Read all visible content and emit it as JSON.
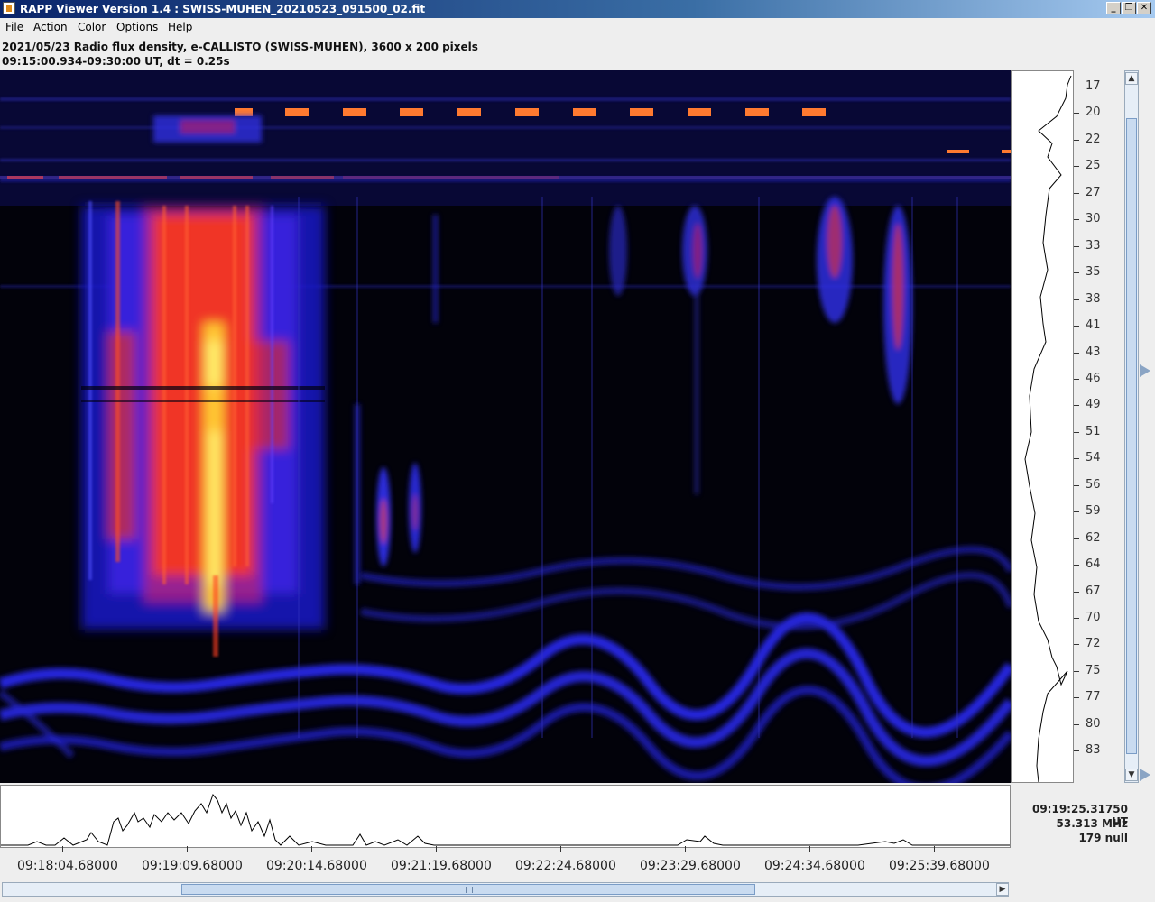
{
  "window": {
    "title": "RAPP Viewer Version 1.4 : SWISS-MUHEN_20210523_091500_02.fit",
    "minimize_label": "_",
    "restore_label": "❐",
    "close_label": "✕"
  },
  "menu": [
    "File",
    "Action",
    "Color",
    "Options",
    "Help"
  ],
  "header": {
    "line1": "2021/05/23  Radio flux density, e-CALLISTO (SWISS-MUHEN),  3600 x 200 pixels",
    "line2": "09:15:00.934-09:30:00 UT,  dt = 0.25s"
  },
  "freq_axis": {
    "ticks": [
      "17",
      "20",
      "22",
      "25",
      "27",
      "30",
      "33",
      "35",
      "38",
      "41",
      "43",
      "46",
      "49",
      "51",
      "54",
      "56",
      "59",
      "62",
      "64",
      "67",
      "70",
      "72",
      "75",
      "77",
      "80",
      "83"
    ]
  },
  "time_axis": {
    "labels": [
      "09:18:04.68000",
      "09:19:09.68000",
      "09:20:14.68000",
      "09:21:19.68000",
      "09:22:24.68000",
      "09:23:29.68000",
      "09:24:34.68000",
      "09:25:39.68000"
    ]
  },
  "cursor_readout": {
    "time": "09:19:25.31750 UT",
    "frequency": "53.313 MHz",
    "value": "179 null"
  },
  "colors": {
    "background": "#02020a",
    "low": "#1a1ad8",
    "mid": "#ff4010",
    "high": "#ffe840"
  }
}
